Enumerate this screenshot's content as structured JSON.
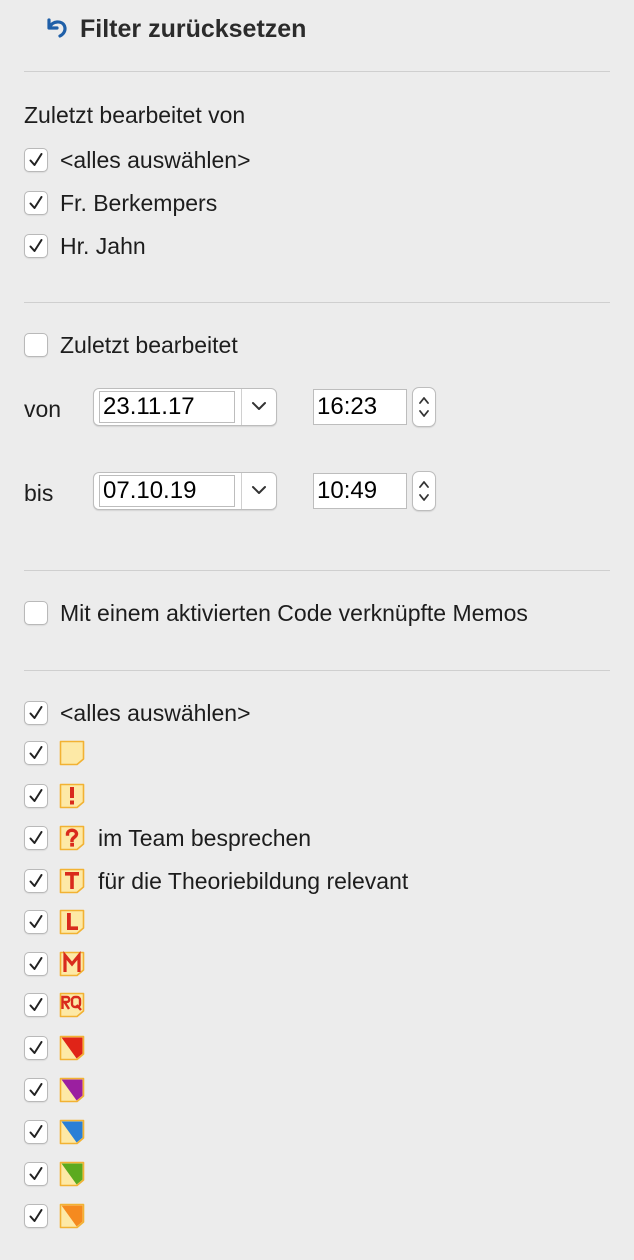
{
  "header": {
    "reset_label": "Filter zurücksetzen"
  },
  "edited_by": {
    "title": "Zuletzt bearbeitet von",
    "items": [
      {
        "label": "<alles auswählen>",
        "checked": true
      },
      {
        "label": "Fr. Berkempers",
        "checked": true
      },
      {
        "label": "Hr. Jahn",
        "checked": true
      }
    ]
  },
  "last_edited": {
    "label": "Zuletzt bearbeitet",
    "checked": false,
    "from": {
      "label": "von",
      "date": "23.11.17",
      "time": "16:23"
    },
    "to": {
      "label": "bis",
      "date": "07.10.19",
      "time": "10:49"
    }
  },
  "code_memos": {
    "label": "Mit einem aktivierten Code verknüpfte Memos",
    "checked": false
  },
  "memo_types": {
    "select_all": {
      "label": "<alles auswählen>",
      "checked": true
    },
    "items": [
      {
        "icon": "memo-plain-icon",
        "label": "",
        "checked": true
      },
      {
        "icon": "memo-exclamation-icon",
        "label": "",
        "checked": true
      },
      {
        "icon": "memo-question-icon",
        "label": "im Team besprechen",
        "checked": true
      },
      {
        "icon": "memo-t-icon",
        "label": "für die Theoriebildung relevant",
        "checked": true
      },
      {
        "icon": "memo-l-icon",
        "label": "",
        "checked": true
      },
      {
        "icon": "memo-m-icon",
        "label": "",
        "checked": true
      },
      {
        "icon": "memo-rq-icon",
        "label": "",
        "checked": true
      },
      {
        "icon": "memo-red-icon",
        "label": "",
        "checked": true
      },
      {
        "icon": "memo-purple-icon",
        "label": "",
        "checked": true
      },
      {
        "icon": "memo-blue-icon",
        "label": "",
        "checked": true
      },
      {
        "icon": "memo-green-icon",
        "label": "",
        "checked": true
      },
      {
        "icon": "memo-orange-icon",
        "label": "",
        "checked": true
      }
    ]
  },
  "colors": {
    "accent": "#1f5fa8",
    "memo_fill": "#fde9a6",
    "memo_border": "#f2b233",
    "memo_letter": "#d92b1c",
    "tri_red": "#e02418",
    "tri_purple": "#9b1fa0",
    "tri_blue": "#2a7fd6",
    "tri_green": "#5caa1f",
    "tri_orange": "#f58a1f"
  }
}
